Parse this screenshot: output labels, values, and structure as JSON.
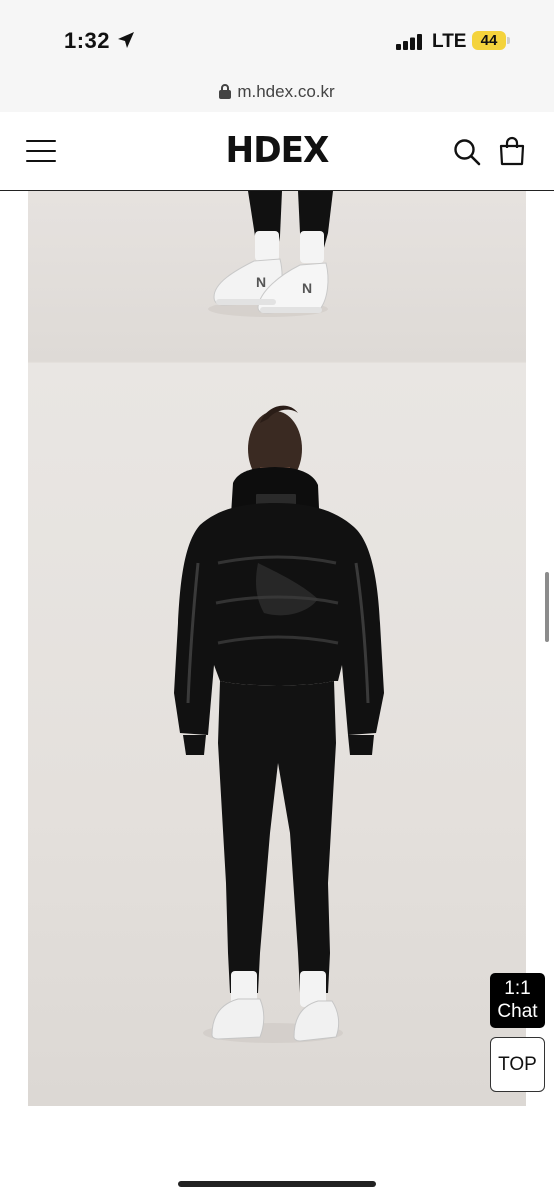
{
  "status_bar": {
    "time": "1:32",
    "network": "LTE",
    "battery": "44"
  },
  "browser": {
    "url": "m.hdex.co.kr"
  },
  "header": {
    "logo": "HDEX"
  },
  "floating": {
    "chat_line1": "1:1",
    "chat_line2": "Chat",
    "top_label": "TOP"
  },
  "colors": {
    "battery": "#f4d33c",
    "photo_background": "#e6e2df",
    "garment": "#111111"
  },
  "icons": [
    "location-arrow-icon",
    "signal-icon",
    "lock-icon",
    "hamburger-menu-icon",
    "search-icon",
    "shopping-bag-icon"
  ]
}
